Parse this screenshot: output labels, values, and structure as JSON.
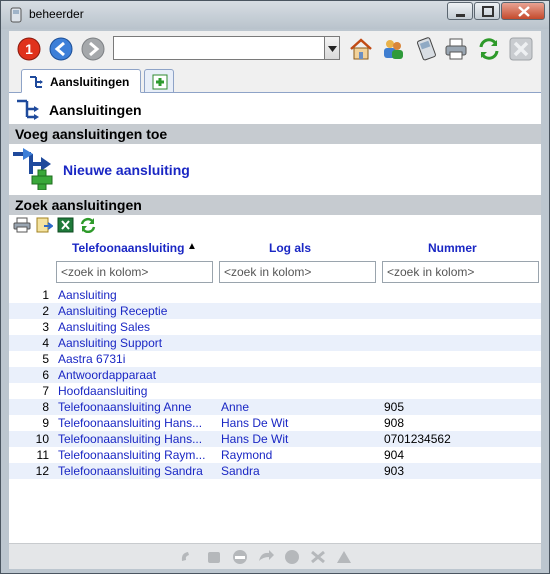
{
  "window": {
    "title": "beheerder"
  },
  "toolbar": {
    "url_value": "",
    "icons": [
      "error-icon",
      "back-icon",
      "forward-icon",
      "home-icon",
      "users-icon",
      "phone-icon",
      "printer-icon",
      "refresh-icon",
      "close-icon"
    ]
  },
  "tabs": [
    {
      "label": "Aansluitingen"
    }
  ],
  "page": {
    "title": "Aansluitingen"
  },
  "sections": {
    "add": "Voeg aansluitingen toe",
    "search": "Zoek aansluitingen"
  },
  "new_connection_label": "Nieuwe aansluiting",
  "table": {
    "columns": [
      "Telefoonaansluiting",
      "Log als",
      "Nummer"
    ],
    "sort_indicator": "▲",
    "filter_placeholder": "<zoek in kolom>",
    "rows": [
      {
        "num": "1",
        "name": "Aansluiting",
        "login": "",
        "number": ""
      },
      {
        "num": "2",
        "name": "Aansluiting Receptie",
        "login": "",
        "number": ""
      },
      {
        "num": "3",
        "name": "Aansluiting Sales",
        "login": "",
        "number": ""
      },
      {
        "num": "4",
        "name": "Aansluiting Support",
        "login": "",
        "number": ""
      },
      {
        "num": "5",
        "name": "Aastra 6731i",
        "login": "",
        "number": ""
      },
      {
        "num": "6",
        "name": "Antwoordapparaat",
        "login": "",
        "number": ""
      },
      {
        "num": "7",
        "name": "Hoofdaansluiting",
        "login": "",
        "number": ""
      },
      {
        "num": "8",
        "name": "Telefoonaansluiting Anne",
        "login": "Anne",
        "number": "905"
      },
      {
        "num": "9",
        "name": "Telefoonaansluiting Hans...",
        "login": "Hans De Wit",
        "number": "908"
      },
      {
        "num": "10",
        "name": "Telefoonaansluiting Hans...",
        "login": "Hans De Wit",
        "number": "0701234562"
      },
      {
        "num": "11",
        "name": "Telefoonaansluiting Raym...",
        "login": "Raymond",
        "number": "904"
      },
      {
        "num": "12",
        "name": "Telefoonaansluiting Sandra",
        "login": "Sandra",
        "number": "903"
      }
    ]
  },
  "colors": {
    "link": "#1a27c4",
    "section_bg": "#c6cbd0",
    "alt_row": "#eaf0fb"
  }
}
